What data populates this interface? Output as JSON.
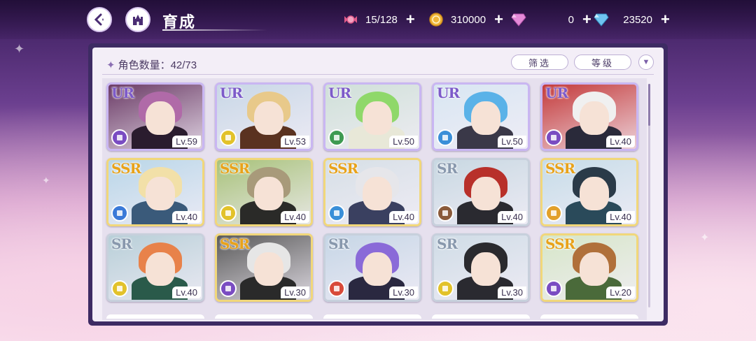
{
  "header": {
    "title": "育成",
    "resources": [
      {
        "name": "candy",
        "icon": "candy-icon",
        "value": "15/128",
        "color": "#e05a8a"
      },
      {
        "name": "coin",
        "icon": "gold-coin-icon",
        "value": "310000",
        "color": "#f0b63a"
      },
      {
        "name": "pink-gem",
        "icon": "pink-diamond-icon",
        "value": "0",
        "color": "#e48ad8"
      },
      {
        "name": "blue-gem",
        "icon": "blue-diamond-icon",
        "value": "23520",
        "color": "#6fc4f0"
      }
    ]
  },
  "panel": {
    "count_label": "角色数量：42/73",
    "filter_label": "筛选",
    "level_label": "等级",
    "sort_icon": "triangle-down-icon"
  },
  "cards": [
    {
      "rarity": "UR",
      "level": "Lv.59",
      "elem_color": "#7a4cc2",
      "frame": "#c9b6f2",
      "bg": "#6b3b66",
      "hair": "#b06aa8",
      "body": "#2a1c2e"
    },
    {
      "rarity": "UR",
      "level": "Lv.53",
      "elem_color": "#e2c22a",
      "frame": "#c9b6f2",
      "bg": "#c8d7e6",
      "hair": "#e8c98a",
      "body": "#5a3220"
    },
    {
      "rarity": "UR",
      "level": "Lv.50",
      "elem_color": "#3e9a52",
      "frame": "#c9b6f2",
      "bg": "#cfe0d8",
      "hair": "#8fd86a",
      "body": "#e8e8d8"
    },
    {
      "rarity": "UR",
      "level": "Lv.50",
      "elem_color": "#3a8fd8",
      "frame": "#c9b6f2",
      "bg": "#d8e6f2",
      "hair": "#5ab2e8",
      "body": "#3a3848"
    },
    {
      "rarity": "UR",
      "level": "Lv.40",
      "elem_color": "#7a4cc2",
      "frame": "#c9b6f2",
      "bg": "#c43a3a",
      "hair": "#f0f0f0",
      "body": "#2a2a3a"
    },
    {
      "rarity": "SSR",
      "level": "Lv.40",
      "elem_color": "#3a7ad8",
      "frame": "#f1d77a",
      "bg": "#b9d6e8",
      "hair": "#f2e0a8",
      "body": "#3a5a7a"
    },
    {
      "rarity": "SSR",
      "level": "Lv.40",
      "elem_color": "#e2c22a",
      "frame": "#f1d77a",
      "bg": "#a8c27a",
      "hair": "#a89a7a",
      "body": "#2a2a28"
    },
    {
      "rarity": "SSR",
      "level": "Lv.40",
      "elem_color": "#3a8fd8",
      "frame": "#f1d77a",
      "bg": "#d6dfe6",
      "hair": "#e6e6ea",
      "body": "#3a4060"
    },
    {
      "rarity": "SR",
      "level": "Lv.40",
      "elem_color": "#8a5a3a",
      "frame": "#c7d0dc",
      "bg": "#c8d8e2",
      "hair": "#b8302a",
      "body": "#2a2a30"
    },
    {
      "rarity": "SSR",
      "level": "Lv.40",
      "elem_color": "#e2a02a",
      "frame": "#f1d77a",
      "bg": "#c6dce8",
      "hair": "#2a3a48",
      "body": "#2a4a5a"
    },
    {
      "rarity": "SR",
      "level": "Lv.40",
      "elem_color": "#e2c22a",
      "frame": "#c7d0dc",
      "bg": "#b8cfd8",
      "hair": "#e8824a",
      "body": "#2a5a4a"
    },
    {
      "rarity": "SSR",
      "level": "Lv.30",
      "elem_color": "#7a4cc2",
      "frame": "#f1d77a",
      "bg": "#5a5a5a",
      "hair": "#e6e6e6",
      "body": "#2a2a2a"
    },
    {
      "rarity": "SR",
      "level": "Lv.30",
      "elem_color": "#d84a3a",
      "frame": "#c7d0dc",
      "bg": "#c6d6e6",
      "hair": "#8a6ad8",
      "body": "#2a2840"
    },
    {
      "rarity": "SR",
      "level": "Lv.30",
      "elem_color": "#e2c22a",
      "frame": "#c7d0dc",
      "bg": "#cfdce6",
      "hair": "#2a2a2e",
      "body": "#2a2a30"
    },
    {
      "rarity": "SSR",
      "level": "Lv.20",
      "elem_color": "#7a4cc2",
      "frame": "#f1d77a",
      "bg": "#d6e6c8",
      "hair": "#b0703a",
      "body": "#4a6a3a"
    }
  ]
}
